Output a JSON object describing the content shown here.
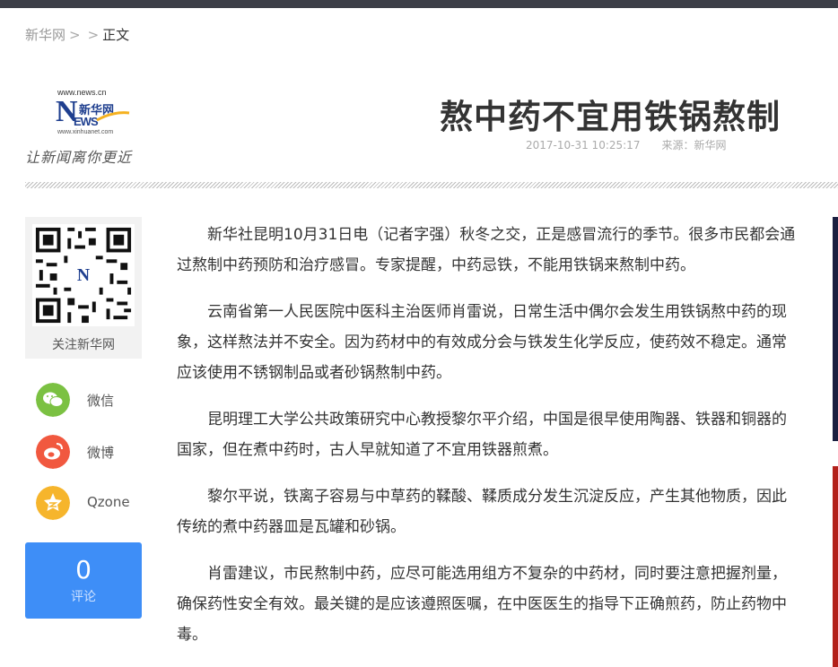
{
  "breadcrumb": {
    "home": "新华网",
    "sep1": ">",
    "sep2": ">",
    "current": "正文"
  },
  "logo": {
    "url_top": "www.news.cn",
    "letter": "N",
    "name": "新华网",
    "ews": "EWS",
    "domain_small": "www.xinhuanet.com",
    "slogan": "让新闻离你更近"
  },
  "article": {
    "title": "熬中药不宜用铁锅熬制",
    "datetime": "2017-10-31 10:25:17",
    "source": "来源：新华网",
    "paragraphs": [
      "新华社昆明10月31日电（记者字强）秋冬之交，正是感冒流行的季节。很多市民都会通过熬制中药预防和治疗感冒。专家提醒，中药忌铁，不能用铁锅来熬制中药。",
      "云南省第一人民医院中医科主治医师肖雷说，日常生活中偶尔会发生用铁锅熬中药的现象，这样熬法并不安全。因为药材中的有效成分会与铁发生化学反应，使药效不稳定。通常应该使用不锈钢制品或者砂锅熬制中药。",
      "昆明理工大学公共政策研究中心教授黎尔平介绍，中国是很早使用陶器、铁器和铜器的国家，但在煮中药时，古人早就知道了不宜用铁器煎煮。",
      "黎尔平说，铁离子容易与中草药的鞣酸、鞣质成分发生沉淀反应，产生其他物质，因此传统的煮中药器皿是瓦罐和砂锅。",
      "肖雷建议，市民熬制中药，应尽可能选用组方不复杂的中药材，同时要注意把握剂量，确保药性安全有效。最关键的是应该遵照医嘱，在中医医生的指导下正确煎药，防止药物中毒。"
    ]
  },
  "sidebar": {
    "qr_label": "关注新华网",
    "share": [
      {
        "label": "微信",
        "icon": "wechat-icon",
        "color": "#7bc142"
      },
      {
        "label": "微博",
        "icon": "weibo-icon",
        "color": "#f1583f"
      },
      {
        "label": "Qzone",
        "icon": "qzone-icon",
        "color": "#f6b52c"
      }
    ],
    "comment_count": "0",
    "comment_label": "评论"
  },
  "colors": {
    "topbar": "#3c3f47",
    "comment_bg": "#3e8ef7",
    "logo_blue": "#1f3f8f"
  }
}
